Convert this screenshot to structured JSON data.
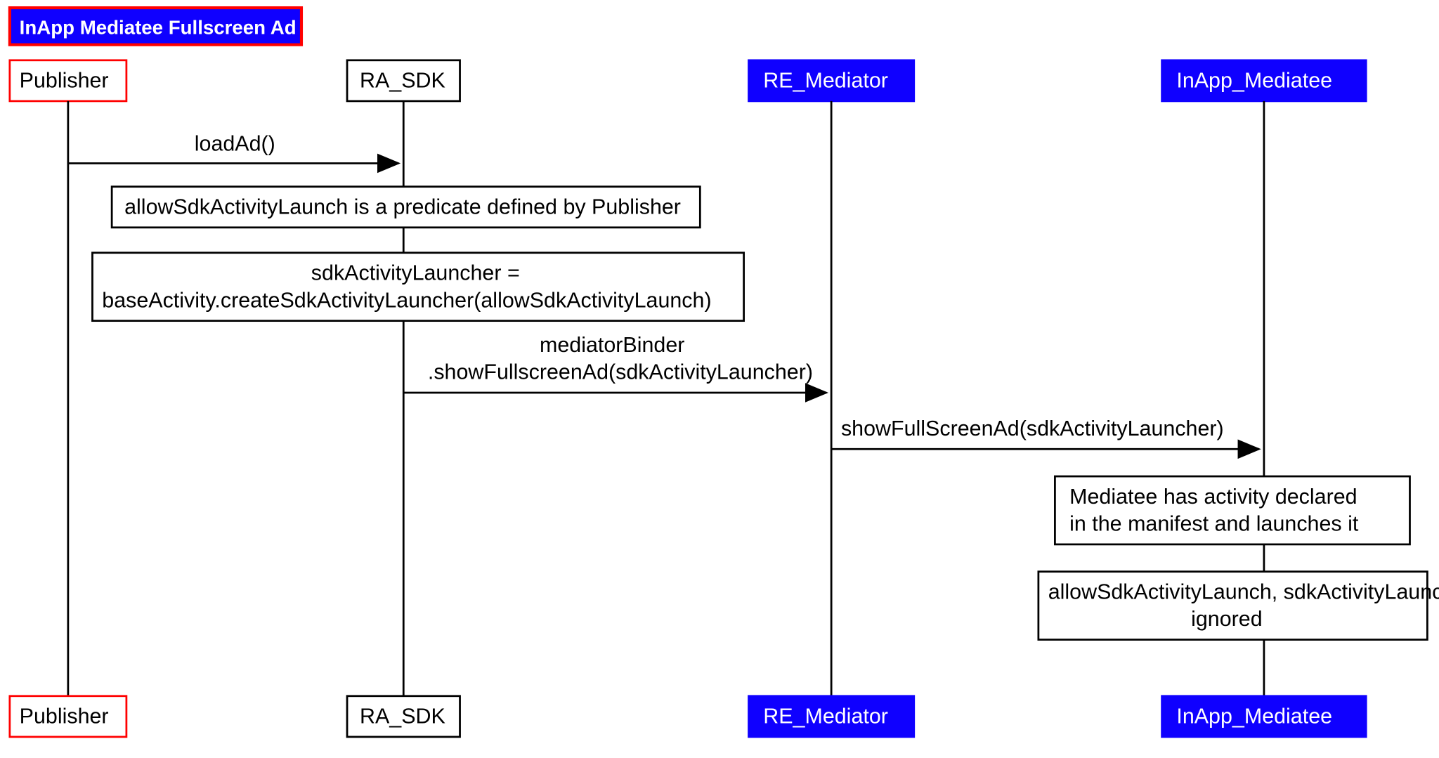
{
  "title": "InApp Mediatee Fullscreen Ad",
  "actors": {
    "publisher": "Publisher",
    "ra_sdk": "RA_SDK",
    "re_mediator": "RE_Mediator",
    "inapp_mediatee": "InApp_Mediatee"
  },
  "messages": {
    "loadAd": "loadAd()",
    "mediatorBinder_l1": "mediatorBinder",
    "mediatorBinder_l2": ".showFullscreenAd(sdkActivityLauncher)",
    "showFullScreenAd": "showFullScreenAd(sdkActivityLauncher)"
  },
  "notes": {
    "predicate": "allowSdkActivityLaunch is a predicate defined by Publisher",
    "launcher_l1": "sdkActivityLauncher =",
    "launcher_l2": "baseActivity.createSdkActivityLauncher(allowSdkActivityLaunch)",
    "mediatee_l1": "Mediatee has activity declared",
    "mediatee_l2": "in the manifest and launches it",
    "ignored_l1": "allowSdkActivityLaunch, sdkActivityLauncher",
    "ignored_l2": "ignored"
  }
}
